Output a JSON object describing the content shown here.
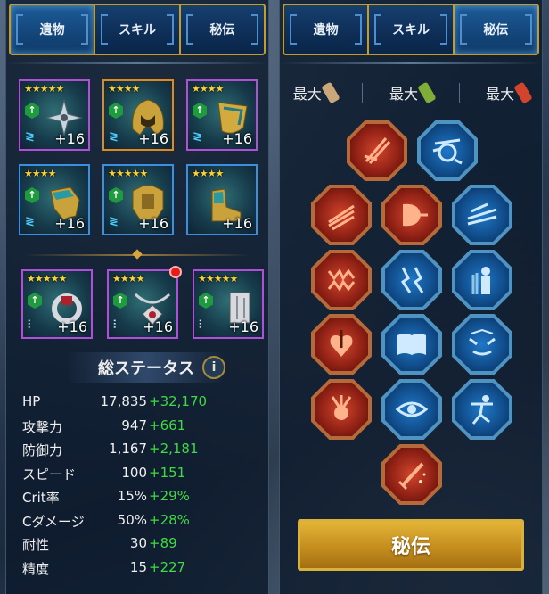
{
  "left_panel": {
    "tabs": [
      {
        "label": "遺物"
      },
      {
        "label": "スキル"
      },
      {
        "label": "秘伝"
      }
    ],
    "gear": [
      {
        "stars": "★★★★★",
        "level": "+16",
        "rarity": "epic",
        "icon": "shuriken-icon"
      },
      {
        "stars": "★★★★",
        "level": "+16",
        "rarity": "legendary",
        "icon": "hood-helmet-icon"
      },
      {
        "stars": "★★★★",
        "level": "+16",
        "rarity": "epic",
        "icon": "shield-icon"
      },
      {
        "stars": "★★★★",
        "level": "+16",
        "rarity": "rare",
        "icon": "gauntlet-icon"
      },
      {
        "stars": "★★★★★",
        "level": "+16",
        "rarity": "rare",
        "icon": "chest-armor-icon"
      },
      {
        "stars": "★★★★",
        "level": "+16",
        "rarity": "rare",
        "icon": "boots-icon"
      }
    ],
    "accessories": [
      {
        "stars": "★★★★★",
        "level": "+16",
        "icon": "ring-icon"
      },
      {
        "stars": "★★★★",
        "level": "+16",
        "icon": "amulet-icon",
        "notification": true
      },
      {
        "stars": "★★★★★",
        "level": "+16",
        "icon": "banner-icon"
      }
    ],
    "stats_title": "総ステータス",
    "info_label": "i",
    "stats": [
      {
        "label": "HP",
        "base": "17,835",
        "bonus": "+32,170"
      },
      {
        "label": "攻撃力",
        "base": "947",
        "bonus": "+661"
      },
      {
        "label": "防御力",
        "base": "1,167",
        "bonus": "+2,181"
      },
      {
        "label": "スピード",
        "base": "100",
        "bonus": "+151"
      },
      {
        "label": "Crit率",
        "base": "15%",
        "bonus": "+29%"
      },
      {
        "label": "Cダメージ",
        "base": "50%",
        "bonus": "+28%"
      },
      {
        "label": "耐性",
        "base": "30",
        "bonus": "+89"
      },
      {
        "label": "精度",
        "base": "15",
        "bonus": "+227"
      }
    ]
  },
  "right_panel": {
    "tabs": [
      {
        "label": "遺物"
      },
      {
        "label": "スキル"
      },
      {
        "label": "秘伝"
      }
    ],
    "max_labels": [
      "最大",
      "最大",
      "最大"
    ],
    "potions": [
      "potion-tan-icon",
      "potion-green-icon",
      "potion-red-icon"
    ],
    "skills": [
      {
        "color": "red",
        "icon": "blade-strike-icon"
      },
      {
        "color": "blue",
        "icon": "fist-impact-icon"
      },
      {
        "color": "red",
        "icon": "claw-slash-icon"
      },
      {
        "color": "red",
        "icon": "shield-bash-icon"
      },
      {
        "color": "blue",
        "icon": "wind-blade-icon"
      },
      {
        "color": "red",
        "icon": "fanged-maw-icon"
      },
      {
        "color": "blue",
        "icon": "lightning-legs-icon"
      },
      {
        "color": "blue",
        "icon": "shadow-figures-icon"
      },
      {
        "color": "red",
        "icon": "bleeding-heart-icon"
      },
      {
        "color": "blue",
        "icon": "open-book-icon"
      },
      {
        "color": "blue",
        "icon": "menacing-face-icon"
      },
      {
        "color": "red",
        "icon": "explosion-swords-icon"
      },
      {
        "color": "blue",
        "icon": "eye-icon"
      },
      {
        "color": "blue",
        "icon": "dancing-figure-icon"
      },
      {
        "color": "red",
        "icon": "sword-hand-icon"
      }
    ],
    "button_label": "秘伝"
  },
  "colors": {
    "bonus_green": "#3fdc3f",
    "tab_gold": "#c79b2a",
    "epic_purple": "#b04fd8",
    "legendary_orange": "#e08a1e",
    "rare_blue": "#3a8fe0"
  }
}
